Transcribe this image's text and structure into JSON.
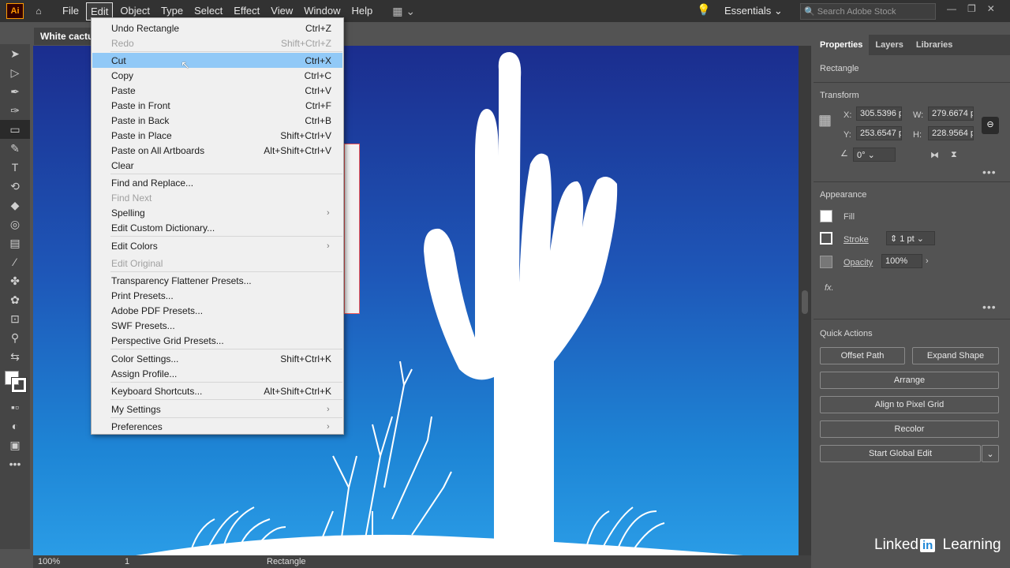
{
  "menubar": {
    "logo": "Ai",
    "menus": [
      "File",
      "Edit",
      "Object",
      "Type",
      "Select",
      "Effect",
      "View",
      "Window",
      "Help"
    ],
    "active_menu": "Edit",
    "workspace": "Essentials",
    "search_placeholder": "Search Adobe Stock"
  },
  "document": {
    "tab_title": "White cactus"
  },
  "edit_menu": {
    "items": [
      {
        "label": "Undo Rectangle",
        "shortcut": "Ctrl+Z",
        "disabled": false
      },
      {
        "label": "Redo",
        "shortcut": "Shift+Ctrl+Z",
        "disabled": true
      },
      {
        "label": "Cut",
        "shortcut": "Ctrl+X",
        "highlighted": true
      },
      {
        "label": "Copy",
        "shortcut": "Ctrl+C"
      },
      {
        "label": "Paste",
        "shortcut": "Ctrl+V"
      },
      {
        "label": "Paste in Front",
        "shortcut": "Ctrl+F"
      },
      {
        "label": "Paste in Back",
        "shortcut": "Ctrl+B"
      },
      {
        "label": "Paste in Place",
        "shortcut": "Shift+Ctrl+V"
      },
      {
        "label": "Paste on All Artboards",
        "shortcut": "Alt+Shift+Ctrl+V"
      },
      {
        "label": "Clear",
        "shortcut": ""
      },
      {
        "label": "Find and Replace...",
        "shortcut": ""
      },
      {
        "label": "Find Next",
        "shortcut": "",
        "disabled": true
      },
      {
        "label": "Spelling",
        "shortcut": "",
        "submenu": true
      },
      {
        "label": "Edit Custom Dictionary...",
        "shortcut": ""
      },
      {
        "label": "Edit Colors",
        "shortcut": "",
        "submenu": true
      },
      {
        "label": "Edit Original",
        "shortcut": "",
        "disabled": true
      },
      {
        "label": "Transparency Flattener Presets...",
        "shortcut": ""
      },
      {
        "label": "Print Presets...",
        "shortcut": ""
      },
      {
        "label": "Adobe PDF Presets...",
        "shortcut": ""
      },
      {
        "label": "SWF Presets...",
        "shortcut": ""
      },
      {
        "label": "Perspective Grid Presets...",
        "shortcut": ""
      },
      {
        "label": "Color Settings...",
        "shortcut": "Shift+Ctrl+K"
      },
      {
        "label": "Assign Profile...",
        "shortcut": ""
      },
      {
        "label": "Keyboard Shortcuts...",
        "shortcut": "Alt+Shift+Ctrl+K"
      },
      {
        "label": "My Settings",
        "shortcut": "",
        "submenu": true
      },
      {
        "label": "Preferences",
        "shortcut": "",
        "submenu": true
      }
    ]
  },
  "properties": {
    "tabs": [
      "Properties",
      "Layers",
      "Libraries"
    ],
    "object_type": "Rectangle",
    "transform": {
      "title": "Transform",
      "x_label": "X:",
      "x": "305.5396 p",
      "y_label": "Y:",
      "y": "253.6547 p",
      "w_label": "W:",
      "w": "279.6674 p",
      "h_label": "H:",
      "h": "228.9564 p",
      "angle": "0°"
    },
    "appearance": {
      "title": "Appearance",
      "fill_label": "Fill",
      "stroke_label": "Stroke",
      "stroke_value": "1 pt",
      "opacity_label": "Opacity",
      "opacity_value": "100%",
      "fx_label": "fx."
    },
    "quick_actions": {
      "title": "Quick Actions",
      "offset_path": "Offset Path",
      "expand_shape": "Expand Shape",
      "arrange": "Arrange",
      "align_pixel": "Align to Pixel Grid",
      "recolor": "Recolor",
      "global_edit": "Start Global Edit"
    }
  },
  "status": {
    "zoom": "100%",
    "artboard": "1",
    "selection": "Rectangle"
  },
  "watermark": {
    "linkedin_a": "Linked",
    "linkedin_in": "in",
    "linkedin_b": "Learning"
  },
  "colors": {
    "menubar": "#323232",
    "panel": "#535353",
    "highlight": "#91c9f7"
  }
}
